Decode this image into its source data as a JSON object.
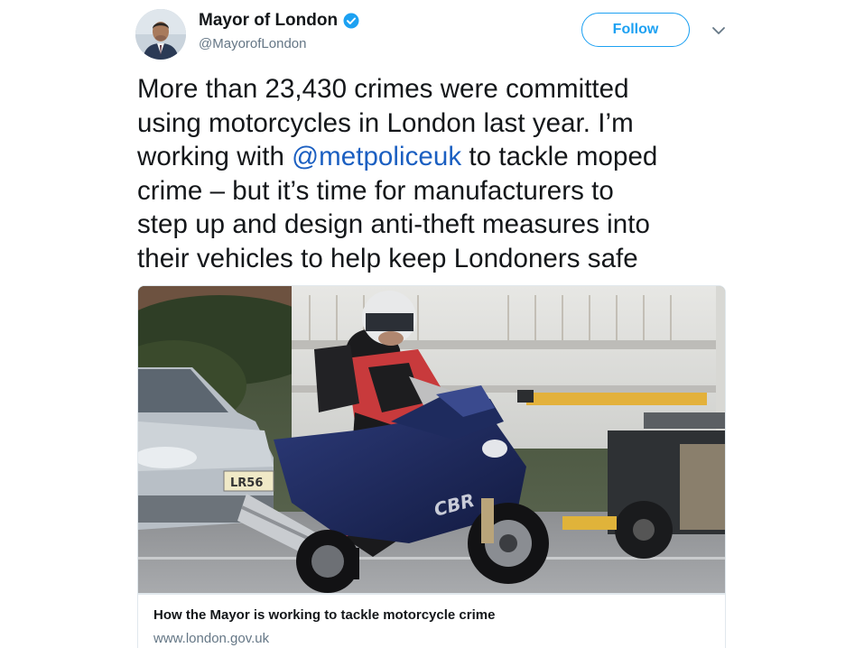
{
  "author": {
    "display_name": "Mayor of London",
    "handle": "@MayorofLondon",
    "verified": true
  },
  "actions": {
    "follow_label": "Follow",
    "more_icon": "chevron-down-icon"
  },
  "tweet": {
    "lines": [
      {
        "text": "More than 23,430 crimes were committed"
      },
      {
        "text": "using motorcycles in London last year. I’m"
      },
      {
        "before": "working with ",
        "mention": "@metpoliceuk",
        "after": " to tackle moped"
      },
      {
        "text": "crime – but it’s time for manufacturers to"
      },
      {
        "text": "step up and design anti-theft measures into"
      },
      {
        "text": "their vehicles to help keep Londoners safe"
      }
    ]
  },
  "card": {
    "title": "How the Mayor is working to tackle motorcycle crime",
    "domain": "www.london.gov.uk",
    "plate_text": "LR56",
    "bike_text": "CBR"
  },
  "colors": {
    "accent": "#1da1f2",
    "mention": "#1b5fc1",
    "text": "#14171a",
    "secondary": "#657786"
  }
}
